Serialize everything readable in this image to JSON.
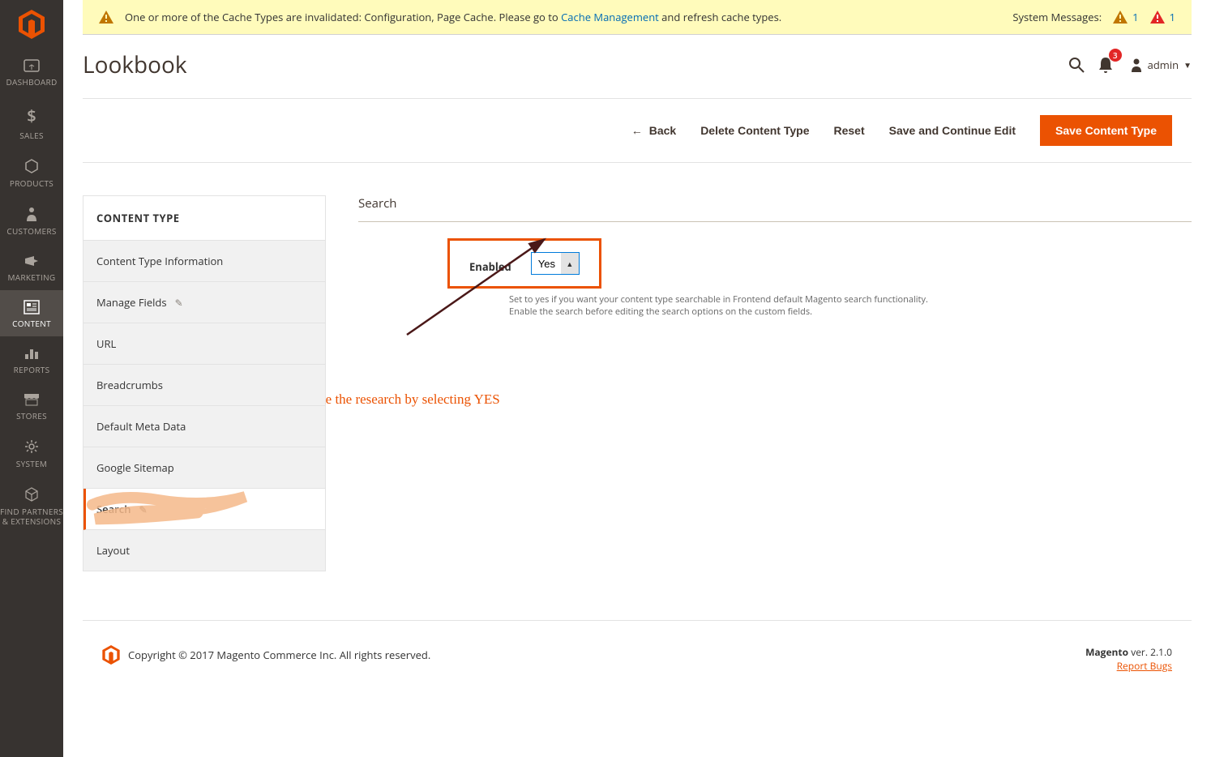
{
  "system_message": {
    "text_prefix": "One or more of the Cache Types are invalidated: Configuration, Page Cache. Please go to ",
    "link_text": "Cache Management",
    "text_suffix": " and refresh cache types.",
    "label": "System Messages:",
    "count1": "1",
    "count2": "1"
  },
  "header": {
    "title": "Lookbook",
    "notifications_count": "3",
    "account_name": "admin"
  },
  "actions": {
    "back": "Back",
    "delete": "Delete Content Type",
    "reset": "Reset",
    "save_continue": "Save and Continue Edit",
    "save": "Save Content Type"
  },
  "sidebar": {
    "items": [
      "DASHBOARD",
      "SALES",
      "PRODUCTS",
      "CUSTOMERS",
      "MARKETING",
      "CONTENT",
      "REPORTS",
      "STORES",
      "SYSTEM",
      "FIND PARTNERS & EXTENSIONS"
    ]
  },
  "leftnav": {
    "title": "CONTENT TYPE",
    "items": [
      "Content Type Information",
      "Manage Fields",
      "URL",
      "Breadcrumbs",
      "Default Meta Data",
      "Google Sitemap",
      "Search",
      "Layout"
    ]
  },
  "form": {
    "section_title": "Search",
    "enabled_label": "Enabled",
    "enabled_value": "Yes",
    "help_line1": "Set to yes if you want your content type searchable in Frontend default Magento search functionality.",
    "help_line2": "Enable the search before editing the search options on the custom fields."
  },
  "annotation": "Enable the research by selecting YES",
  "footer": {
    "copyright": "Copyright © 2017 Magento Commerce Inc. All rights reserved.",
    "brand": "Magento",
    "version": " ver. 2.1.0",
    "report": "Report Bugs"
  }
}
